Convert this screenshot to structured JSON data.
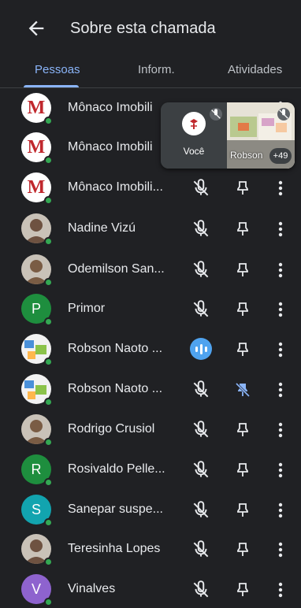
{
  "header": {
    "title": "Sobre esta chamada"
  },
  "tabs": [
    "Pessoas",
    "Inform.",
    "Atividades"
  ],
  "pip": {
    "self_label": "Você",
    "other_name": "Robson",
    "extra_count": "+49"
  },
  "participants": [
    {
      "name": "Mônaco Imobili",
      "avatar": "monaco-logo",
      "mic": "hidden",
      "pinned": false
    },
    {
      "name": "Mônaco Imobili",
      "avatar": "monaco-logo",
      "mic": "hidden",
      "pinned": false
    },
    {
      "name": "Mônaco Imobili...",
      "avatar": "monaco-logo",
      "mic": "muted",
      "pinned": false
    },
    {
      "name": "Nadine Vizú",
      "avatar": "photo",
      "mic": "muted",
      "pinned": false
    },
    {
      "name": "Odemilson San...",
      "avatar": "photo",
      "mic": "muted",
      "pinned": false
    },
    {
      "name": "Primor",
      "avatar": "letter",
      "letter": "P",
      "color": "#1e8e3e",
      "mic": "muted",
      "pinned": false
    },
    {
      "name": "Robson Naoto ...",
      "avatar": "map",
      "mic": "speaking",
      "pinned": false
    },
    {
      "name": "Robson Naoto ...",
      "avatar": "map",
      "mic": "muted",
      "pinned": true
    },
    {
      "name": "Rodrigo Crusiol",
      "avatar": "photo",
      "mic": "muted",
      "pinned": false
    },
    {
      "name": "Rosivaldo Pelle...",
      "avatar": "letter",
      "letter": "R",
      "color": "#1e8e3e",
      "mic": "muted",
      "pinned": false
    },
    {
      "name": "Sanepar suspe...",
      "avatar": "letter",
      "letter": "S",
      "color": "#12a4af",
      "mic": "muted",
      "pinned": false
    },
    {
      "name": "Teresinha Lopes",
      "avatar": "photo",
      "mic": "muted",
      "pinned": false
    },
    {
      "name": "Vinalves",
      "avatar": "letter",
      "letter": "V",
      "color": "#8e63ce",
      "mic": "muted",
      "pinned": false
    }
  ],
  "colors": {
    "background": "#202124",
    "accent": "#8ab4f8",
    "online": "#34a853",
    "speaking": "#4fa3ef"
  }
}
